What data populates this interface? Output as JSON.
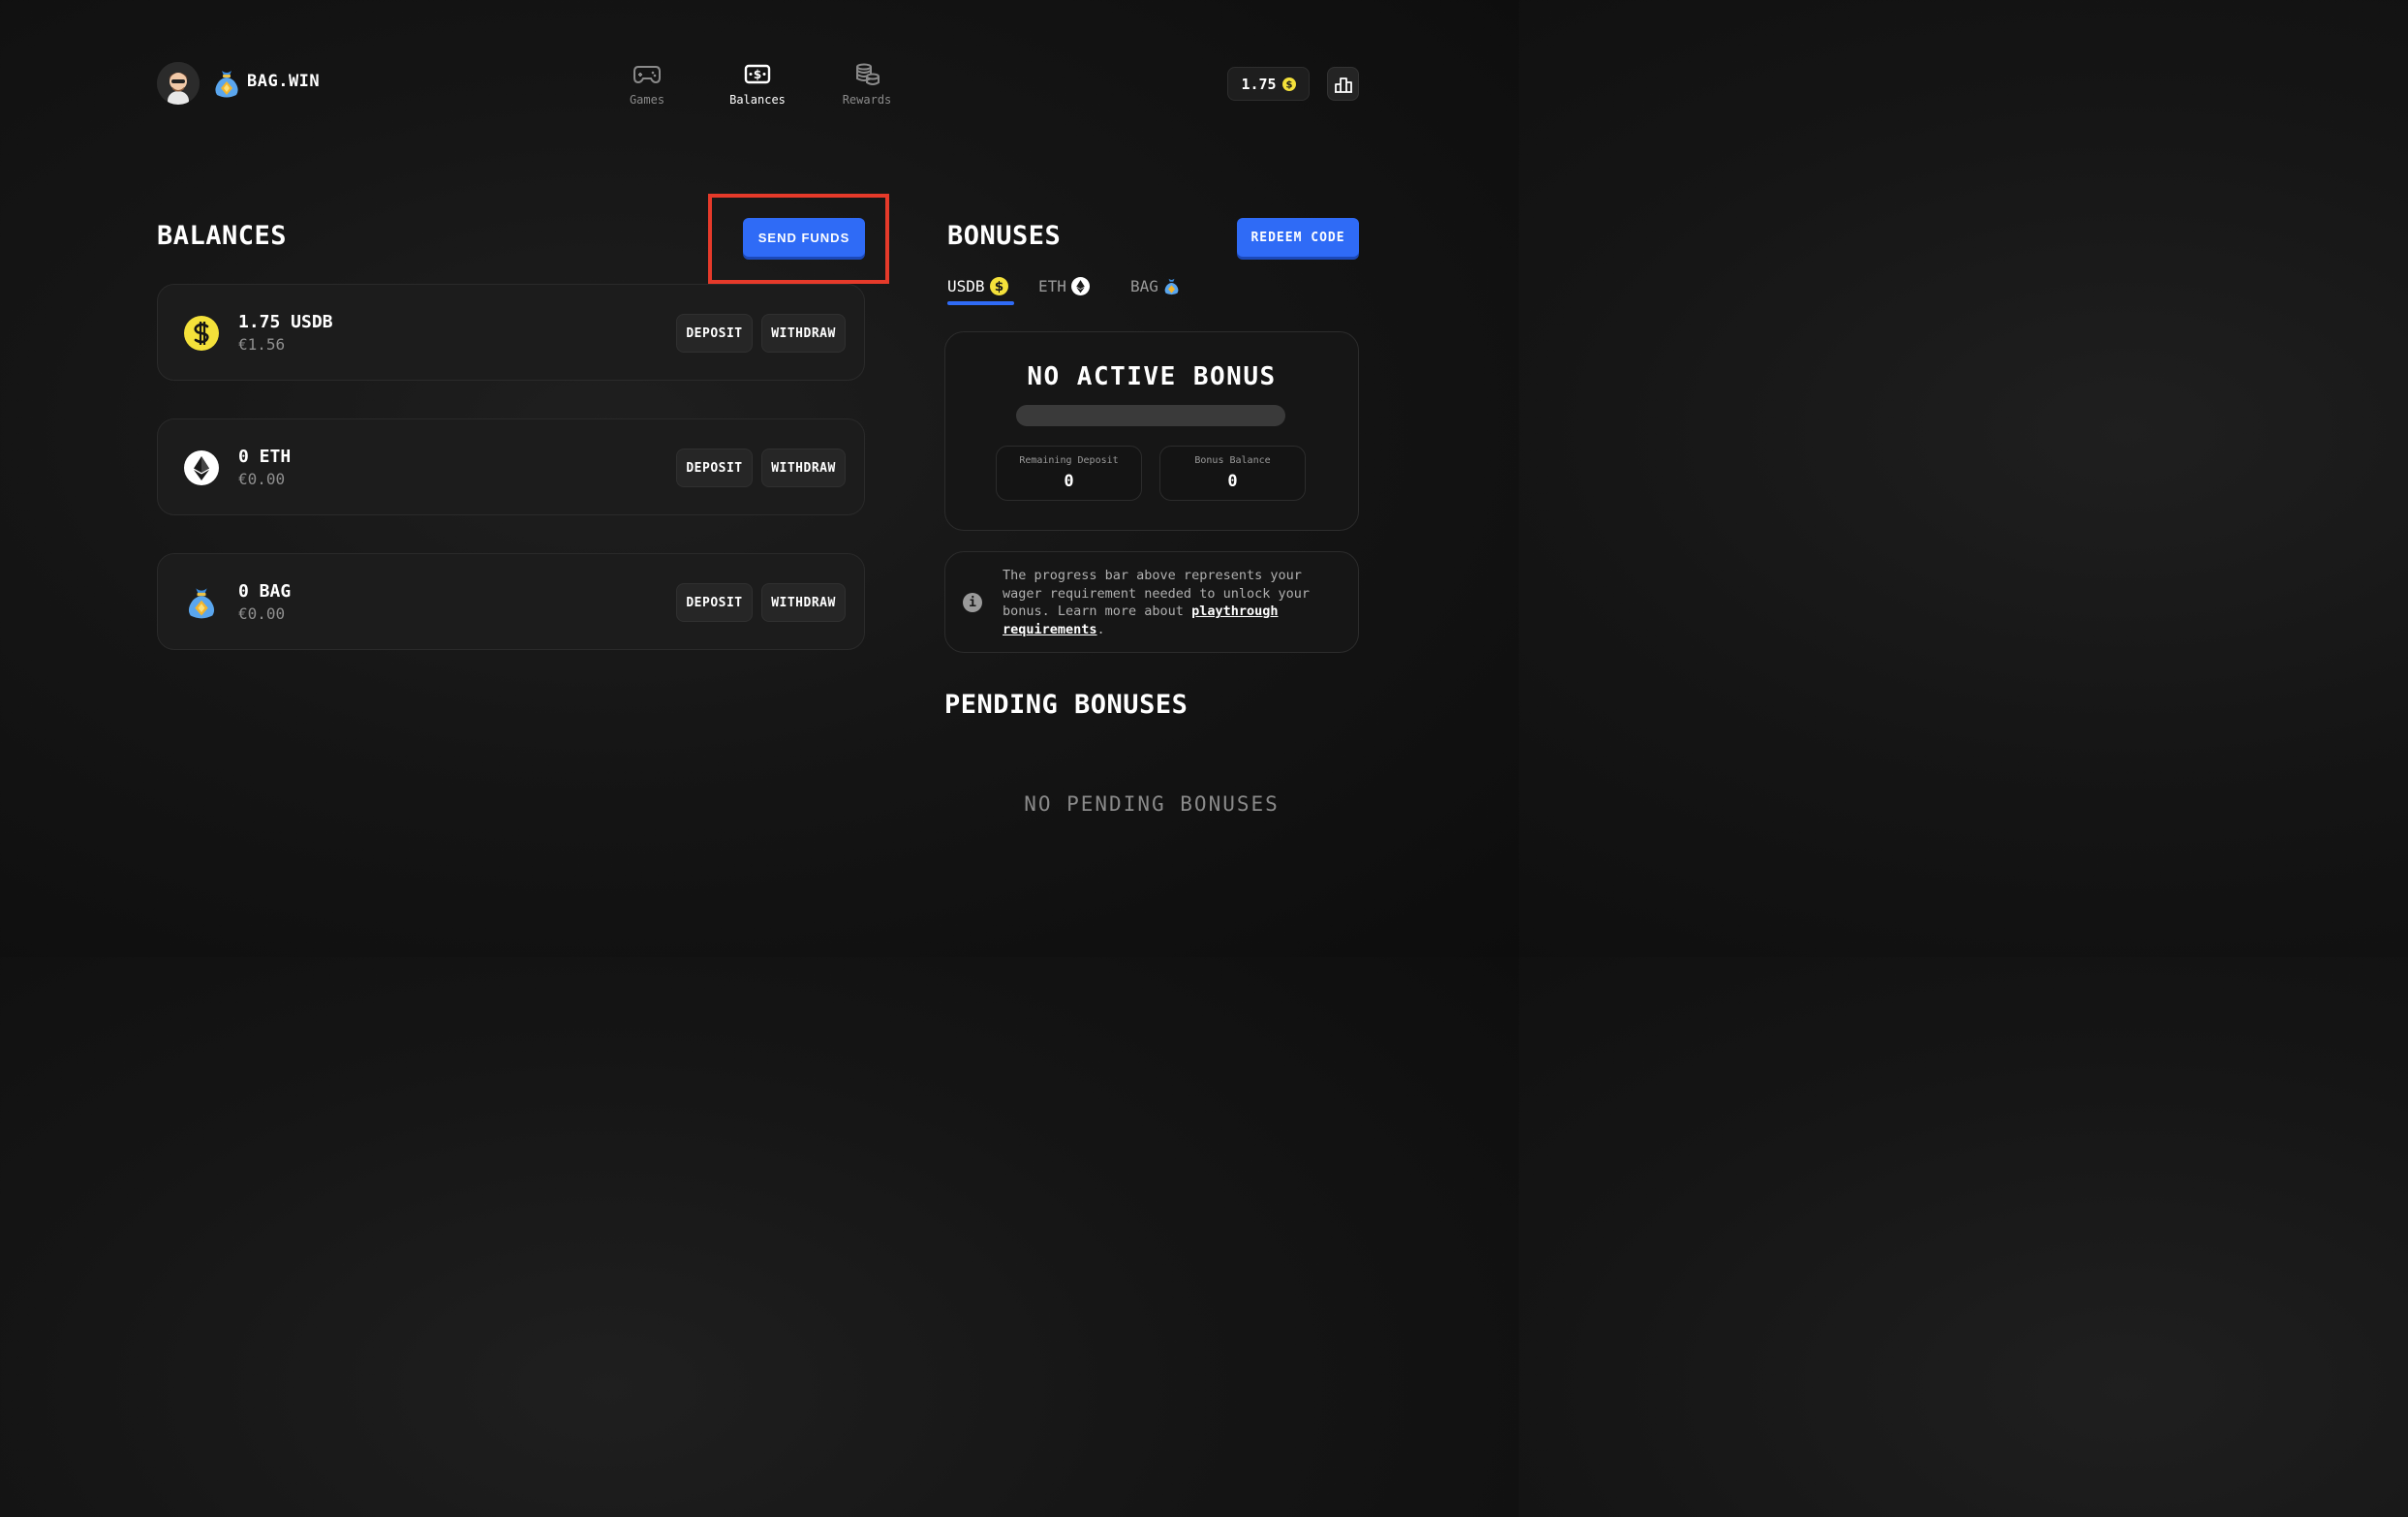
{
  "header": {
    "brand": "BAG.WIN",
    "nav": [
      {
        "label": "Games",
        "icon": "gamepad-icon",
        "active": false
      },
      {
        "label": "Balances",
        "icon": "cash-icon",
        "active": true
      },
      {
        "label": "Rewards",
        "icon": "coins-stack-icon",
        "active": false
      }
    ],
    "balance_value": "1.75",
    "balance_icon": "usdb-coin-icon",
    "leaderboard_icon": "leaderboard-icon"
  },
  "balances": {
    "title": "BALANCES",
    "send_funds_label": "SEND FUNDS",
    "items": [
      {
        "amount": "1.75 USDB",
        "fiat": "€1.56",
        "icon": "usdb-coin-icon",
        "deposit": "DEPOSIT",
        "withdraw": "WITHDRAW"
      },
      {
        "amount": "0 ETH",
        "fiat": "€0.00",
        "icon": "eth-coin-icon",
        "deposit": "DEPOSIT",
        "withdraw": "WITHDRAW"
      },
      {
        "amount": "0 BAG",
        "fiat": "€0.00",
        "icon": "bag-coin-icon",
        "deposit": "DEPOSIT",
        "withdraw": "WITHDRAW"
      }
    ]
  },
  "bonuses": {
    "title": "BONUSES",
    "redeem_label": "REDEEM CODE",
    "tabs": [
      {
        "label": "USDB",
        "icon": "usdb-coin-icon",
        "active": true
      },
      {
        "label": "ETH",
        "icon": "eth-coin-icon",
        "active": false
      },
      {
        "label": "BAG",
        "icon": "bag-coin-icon",
        "active": false
      }
    ],
    "status_title": "NO ACTIVE BONUS",
    "progress": 0,
    "remaining_deposit_label": "Remaining Deposit",
    "remaining_deposit_value": "0",
    "bonus_balance_label": "Bonus Balance",
    "bonus_balance_value": "0",
    "info_text_before": "The progress bar above represents your wager requirement needed to unlock your bonus. Learn more about ",
    "info_link": "playthrough requirements",
    "info_text_after": "."
  },
  "pending": {
    "title": "PENDING BONUSES",
    "empty_text": "NO PENDING BONUSES"
  },
  "colors": {
    "accent": "#2f6bf6",
    "highlight": "#e53a2a",
    "usdb": "#f4e13a"
  }
}
